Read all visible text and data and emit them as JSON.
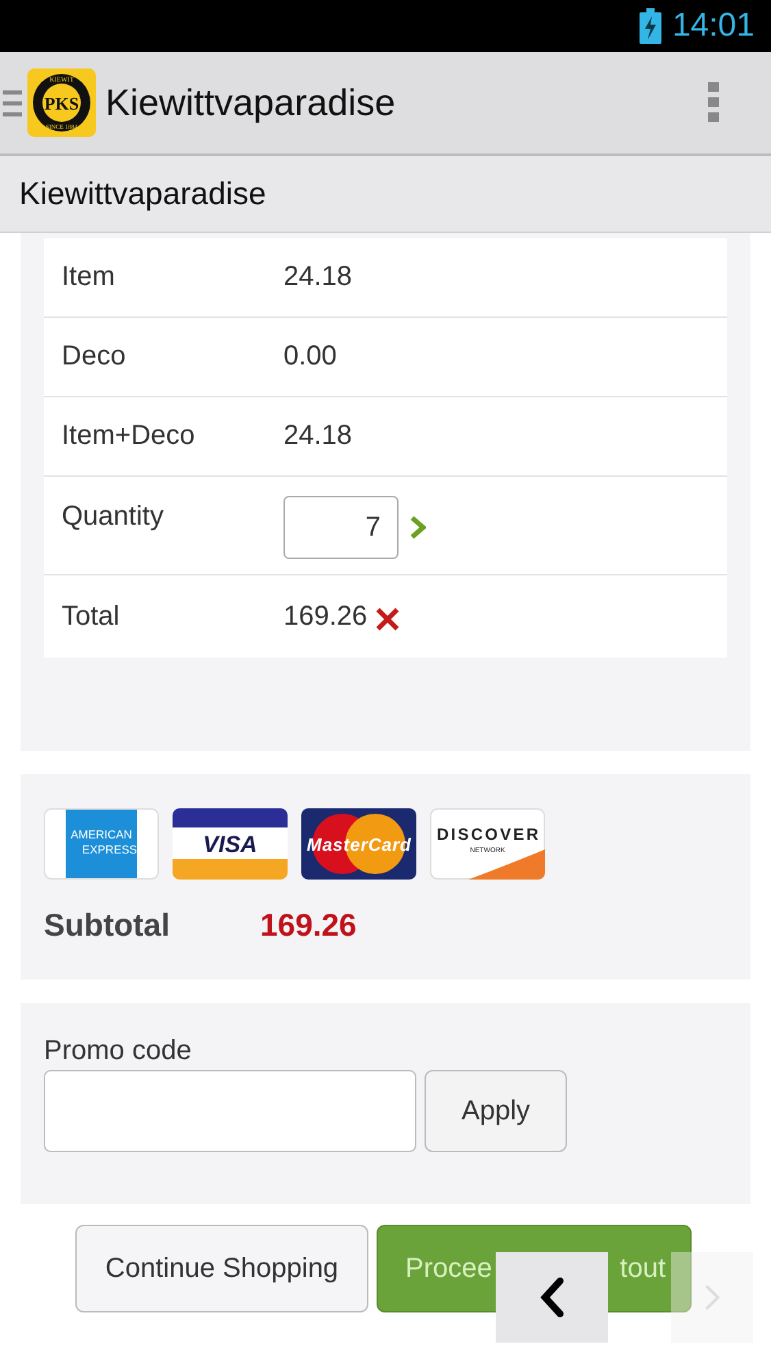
{
  "status_bar": {
    "time": "14:01"
  },
  "action_bar": {
    "logo": {
      "main": "PKS",
      "top": "KIEWIT",
      "bottom": "SINCE 1884"
    },
    "title": "Kiewittvaparadise"
  },
  "subheader": "Kiewittvaparadise",
  "rows": [
    {
      "kind": "text",
      "label": "Item",
      "value": "24.18"
    },
    {
      "kind": "text",
      "label": "Deco",
      "value": "0.00"
    },
    {
      "kind": "text",
      "label": "Item+Deco",
      "value": "24.18"
    },
    {
      "kind": "quantity",
      "label": "Quantity",
      "value": "7"
    },
    {
      "kind": "total",
      "label": "Total",
      "value": "169.26"
    }
  ],
  "cards": [
    {
      "kind": "amex",
      "lines": [
        "AMERICAN",
        "EXPRESS"
      ]
    },
    {
      "kind": "visa",
      "lines": [
        "VISA"
      ]
    },
    {
      "kind": "mastercard",
      "lines": [
        "MasterCard"
      ]
    },
    {
      "kind": "discover",
      "lines": [
        "DISCOVER",
        "NETWORK"
      ]
    }
  ],
  "subtotal": {
    "label": "Subtotal",
    "value": "169.26"
  },
  "promo": {
    "label": "Promo code",
    "button": "Apply"
  },
  "buttons": [
    {
      "kind": "secondary",
      "parts": [
        "Continue Shopping"
      ]
    },
    {
      "kind": "primary",
      "parts": [
        "Procee",
        "tout"
      ]
    }
  ],
  "overlay_nav": [
    {
      "kind": "back"
    },
    {
      "kind": "forward"
    }
  ]
}
